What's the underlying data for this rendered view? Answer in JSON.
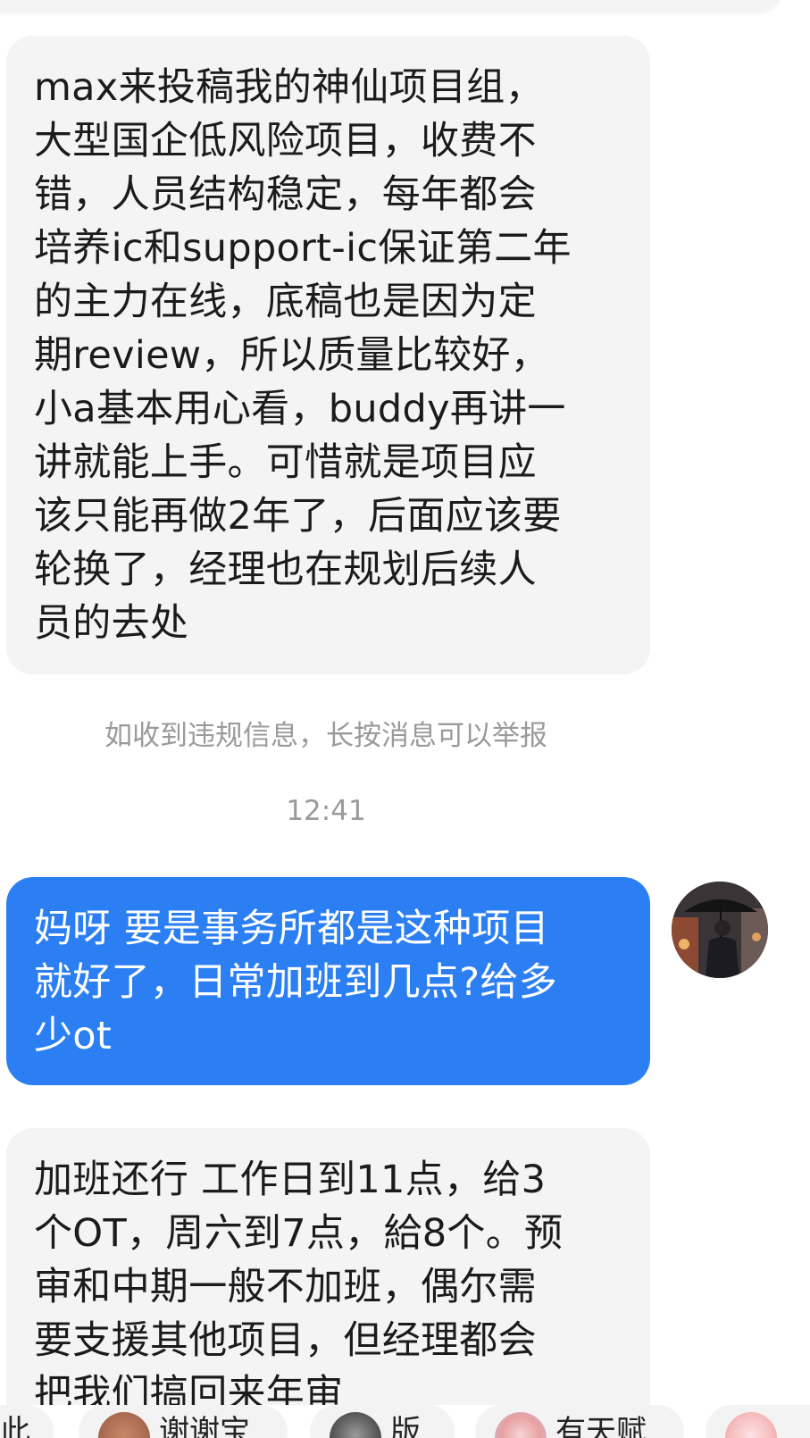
{
  "messages": [
    {
      "id": "msg1",
      "direction": "incoming",
      "text": "max来投稿我的神仙项目组，\n大型国企低风险项目，收费不\n错，人员结构稳定，每年都会\n培养ic和support-ic保证第二年\n的主力在线，底稿也是因为定\n期review，所以质量比较好，\n小a基本用心看，buddy再讲一\n讲就能上手。可惜就是项目应\n该只能再做2年了，后面应该要\n轮换了，经理也在规划后续人\n员的去处"
    },
    {
      "id": "msg2",
      "direction": "outgoing",
      "text": "妈呀 要是事务所都是这种项目\n就好了，日常加班到几点?给多\n少ot"
    },
    {
      "id": "msg3",
      "direction": "incoming",
      "text": "加班还行 工作日到11点，给3\n个OT，周六到7点，給8个。预\n审和中期一般不加班，偶尔需\n要支援其他项目，但经理都会\n把我们搞回来年审"
    }
  ],
  "system_note": "如收到违规信息，长按消息可以举报",
  "timestamp": "12:41",
  "bottom_chips": [
    {
      "label": "此",
      "icon": "partial-icon"
    },
    {
      "label": "谢谢宝",
      "icon": "bear-sticker-icon"
    },
    {
      "label": "版",
      "icon": "cat-sticker-icon"
    },
    {
      "label": "有天赋",
      "icon": "pin-sticker-icon"
    },
    {
      "label": "",
      "icon": "pig-sticker-icon"
    }
  ],
  "colors": {
    "incoming_bubble": "#f4f4f4",
    "outgoing_bubble": "#2b7ff3",
    "meta_text": "#9a9a9a"
  }
}
